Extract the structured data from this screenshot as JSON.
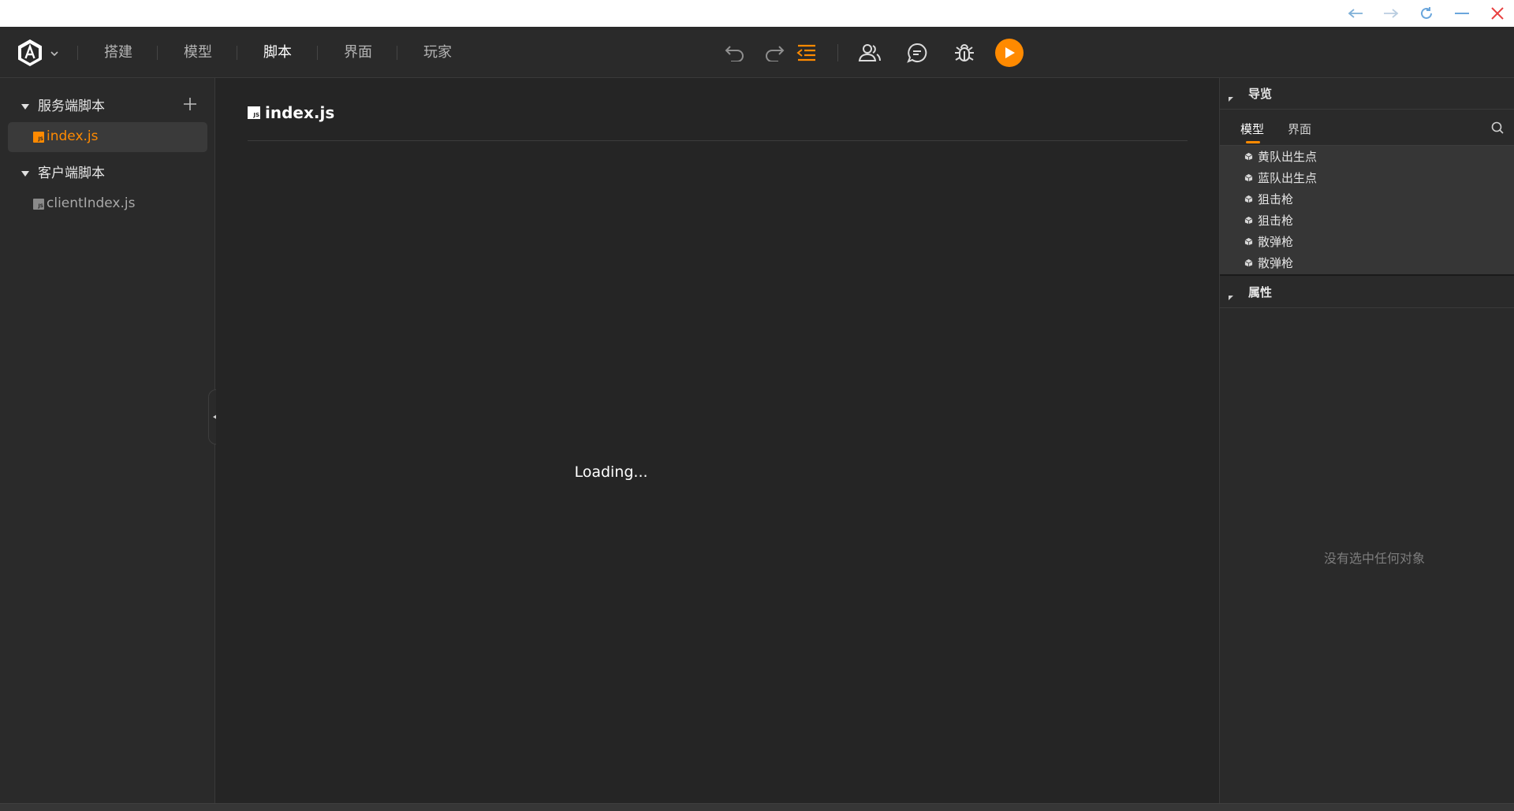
{
  "window_controls": [
    "back-icon",
    "forward-icon",
    "refresh-icon",
    "minimize-icon",
    "close-icon"
  ],
  "toolbar": {
    "nav": [
      {
        "label": "搭建"
      },
      {
        "label": "模型"
      },
      {
        "label": "脚本",
        "active": true
      },
      {
        "label": "界面"
      },
      {
        "label": "玩家"
      }
    ],
    "tools": [
      "undo-icon",
      "redo-icon",
      "outdent-icon",
      "users-icon",
      "chat-icon",
      "debug-bug-icon",
      "play-icon"
    ],
    "accent_color": "#ff8a00"
  },
  "left_panel": {
    "groups": [
      {
        "label": "服务端脚本",
        "files": [
          {
            "name": "index.js",
            "selected": true
          }
        ]
      },
      {
        "label": "客户端脚本",
        "files": [
          {
            "name": "clientIndex.js",
            "selected": false
          }
        ]
      }
    ]
  },
  "editor": {
    "file_title": "index.js",
    "status": "Loading..."
  },
  "right_panel": {
    "outline": {
      "title": "导览",
      "tabs": [
        "模型",
        "界面"
      ],
      "active_tab": "模型",
      "items": [
        "黄队出生点",
        "蓝队出生点",
        "狙击枪",
        "狙击枪",
        "散弹枪",
        "散弹枪"
      ]
    },
    "properties": {
      "title": "属性",
      "empty_message": "没有选中任何对象"
    }
  }
}
